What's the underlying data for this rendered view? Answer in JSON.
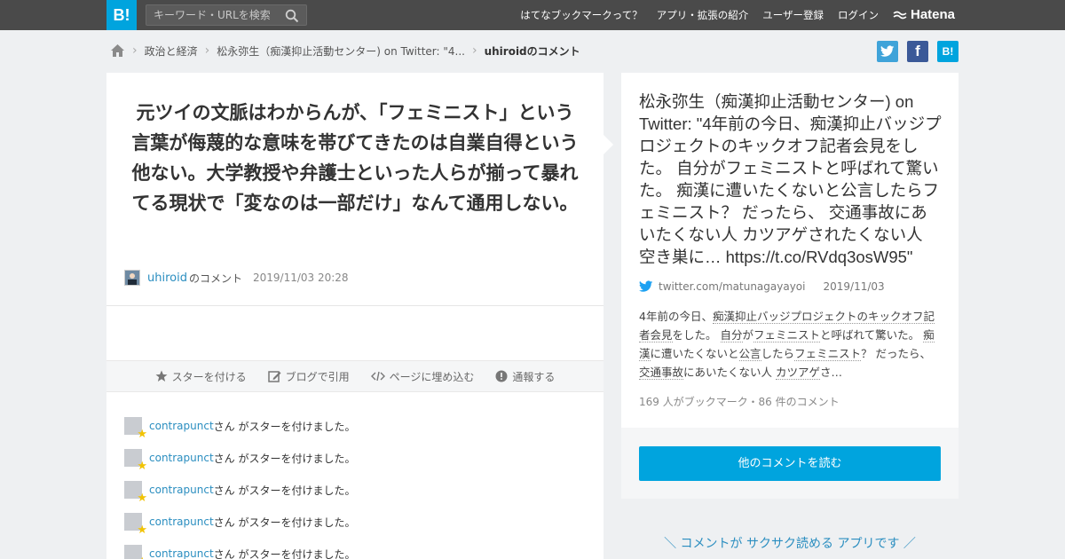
{
  "topbar": {
    "logo": "B!",
    "search_placeholder": "キーワード・URLを検索",
    "nav": [
      "はてなブックマークって？",
      "アプリ・拡張の紹介",
      "ユーザー登録",
      "ログイン"
    ],
    "brand": "Hatena"
  },
  "breadcrumb": {
    "items": [
      "政治と経済",
      "松永弥生（痴漢抑止活動センター) on Twitter: \"4...",
      "uhiroidのコメント"
    ]
  },
  "share": {
    "twitter": "t",
    "facebook": "f",
    "hatena": "B!"
  },
  "comment": {
    "text": "元ツイの文脈はわからんが、「フェミニスト」という言葉が侮蔑的な意味を帯びてきたのは自業自得という他ない。大学教授や弁護士といった人らが揃って暴れてる現状で「変なのは一部だけ」なんて通用しない。",
    "user": "uhiroid",
    "user_suffix": "のコメント",
    "date": "2019/11/03 20:28"
  },
  "actions": [
    "スターを付ける",
    "ブログで引用",
    "ページに埋め込む",
    "通報する"
  ],
  "stars": [
    {
      "user": "contrapunct",
      "text": "さん がスターを付けました。"
    },
    {
      "user": "contrapunct",
      "text": "さん がスターを付けました。"
    },
    {
      "user": "contrapunct",
      "text": "さん がスターを付けました。"
    },
    {
      "user": "contrapunct",
      "text": "さん がスターを付けました。"
    },
    {
      "user": "contrapunct",
      "text": "さん がスターを付けました。"
    }
  ],
  "entry": {
    "title": "松永弥生（痴漢抑止活動センター) on Twitter: \"4年前の今日、痴漢抑止バッジプロジェクトのキックオフ記者会見をした。 自分がフェミニストと呼ばれて驚いた。 痴漢に遭いたくないと公言したらフェミニスト？ だったら、 交通事故にあいたくない人 カツアゲされたくない人 空き巣に… https://t.co/RVdq3osW95\"",
    "domain": "twitter.com/matunagayayoi",
    "date": "2019/11/03",
    "summary_parts": [
      {
        "t": "4年前の今日、",
        "kw": false
      },
      {
        "t": "痴漢抑止バッジプロジェクトのキックオフ記者会見",
        "kw": true
      },
      {
        "t": "をした。 ",
        "kw": false
      },
      {
        "t": "自分",
        "kw": true
      },
      {
        "t": "が",
        "kw": false
      },
      {
        "t": "フェミニスト",
        "kw": true
      },
      {
        "t": "と呼ばれて驚いた。 ",
        "kw": false
      },
      {
        "t": "痴漢",
        "kw": true
      },
      {
        "t": "に遭いたくないと",
        "kw": false
      },
      {
        "t": "公言",
        "kw": true
      },
      {
        "t": "したら",
        "kw": false
      },
      {
        "t": "フェミニスト",
        "kw": true
      },
      {
        "t": "？ だったら、 ",
        "kw": false
      },
      {
        "t": "交通事故",
        "kw": true
      },
      {
        "t": "にあいたくない人 ",
        "kw": false
      },
      {
        "t": "カツアゲ",
        "kw": true
      },
      {
        "t": "さ…",
        "kw": false
      }
    ],
    "counts": "169 人がブックマーク・86 件のコメント"
  },
  "more_button": "他のコメントを読む",
  "app_promo": "＼ コメントが サクサク読める アプリです ／",
  "colors": {
    "accent": "#00a4de",
    "topbar": "#4a4a4a",
    "link": "#2b8ec0"
  }
}
